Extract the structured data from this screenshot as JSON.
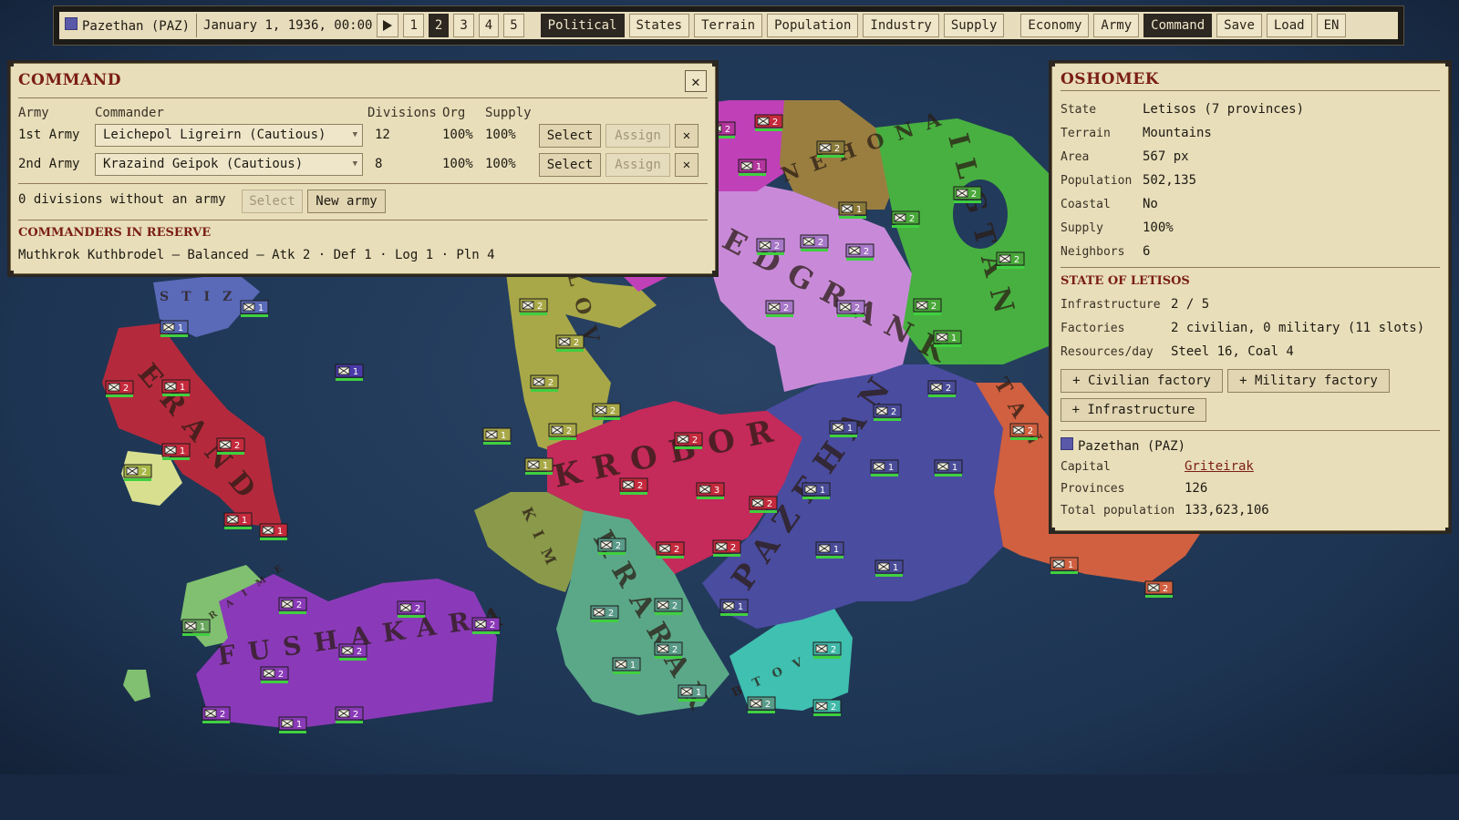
{
  "topbar": {
    "country": "Pazethan (PAZ)",
    "country_color": "#5a58a8",
    "date": "January 1, 1936, 00:00",
    "speeds": [
      "1",
      "2",
      "3",
      "4",
      "5"
    ],
    "active_speed": "2",
    "map_modes": [
      "Political",
      "States",
      "Terrain",
      "Population",
      "Industry",
      "Supply"
    ],
    "active_map_mode": "Political",
    "menus": [
      "Economy",
      "Army",
      "Command",
      "Save",
      "Load",
      "EN"
    ],
    "active_menu": "Command"
  },
  "command": {
    "title": "COMMAND",
    "headers": {
      "army": "Army",
      "commander": "Commander",
      "divisions": "Divisions",
      "org": "Org",
      "supply": "Supply"
    },
    "armies": [
      {
        "name": "1st Army",
        "commander": "Leichepol Ligreirn (Cautious)",
        "divisions": "12",
        "org": "100%",
        "supply": "100%"
      },
      {
        "name": "2nd Army",
        "commander": "Krazaind Geipok (Cautious)",
        "divisions": "8",
        "org": "100%",
        "supply": "100%"
      }
    ],
    "select_label": "Select",
    "assign_label": "Assign",
    "unassigned_text": "0 divisions without an army",
    "new_army_label": "New army",
    "reserve_title": "COMMANDERS IN RESERVE",
    "reserve_line": "Muthkrok Kuthbrodel — Balanced — Atk 2 · Def 1 · Log 1 · Pln 4"
  },
  "province": {
    "title": "OSHOMEK",
    "fields": [
      {
        "k": "State",
        "v": "Letisos (7 provinces)"
      },
      {
        "k": "Terrain",
        "v": "Mountains"
      },
      {
        "k": "Area",
        "v": "567 px"
      },
      {
        "k": "Population",
        "v": "502,135"
      },
      {
        "k": "Coastal",
        "v": "No"
      },
      {
        "k": "Supply",
        "v": "100%"
      },
      {
        "k": "Neighbors",
        "v": "6"
      }
    ],
    "state_title": "STATE OF LETISOS",
    "state_fields": [
      {
        "k": "Infrastructure",
        "v": "2 / 5"
      },
      {
        "k": "Factories",
        "v": "2 civilian, 0 military (11 slots)"
      },
      {
        "k": "Resources/day",
        "v": "Steel 16, Coal 4"
      }
    ],
    "buttons": {
      "civ": "+ Civilian factory",
      "mil": "+ Military factory",
      "infra": "+ Infrastructure"
    },
    "owner": "Pazethan (PAZ)",
    "owner_color": "#5a58a8",
    "owner_fields": [
      {
        "k": "Capital",
        "v": "Griteirak",
        "link": true
      },
      {
        "k": "Provinces",
        "v": "126"
      },
      {
        "k": "Total population",
        "v": "133,623,106"
      }
    ]
  },
  "map": {
    "labels": [
      "STIZ",
      "ERAND",
      "FUSHAKARA",
      "RAIME",
      "KROBOR",
      "LOV",
      "KIM",
      "KRARAK",
      "BTOV",
      "NEHONA",
      "EDGRANK",
      "PAZEHAN",
      "ILGTAN",
      "TAN",
      "OSHOMEK"
    ],
    "units": [
      {
        "n": "2",
        "c": "#c42a3c"
      },
      {
        "n": "2",
        "c": "#b4359e"
      },
      {
        "n": "1",
        "c": "#b4359e"
      },
      {
        "n": "2",
        "c": "#8a7a3a"
      },
      {
        "n": "1",
        "c": "#8a7a3a"
      },
      {
        "n": "2",
        "c": "#4aa83a"
      },
      {
        "n": "2",
        "c": "#4aa83a"
      },
      {
        "n": "2",
        "c": "#4aa83a"
      },
      {
        "n": "1",
        "c": "#4aa83a"
      },
      {
        "n": "2",
        "c": "#4aa83a"
      },
      {
        "n": "2",
        "c": "#a878c8"
      },
      {
        "n": "2",
        "c": "#a878c8"
      },
      {
        "n": "2",
        "c": "#a878c8"
      },
      {
        "n": "2",
        "c": "#a878c8"
      },
      {
        "n": "2",
        "c": "#a878c8"
      },
      {
        "n": "2",
        "c": "#4a4c98"
      },
      {
        "n": "1",
        "c": "#4a4c98"
      },
      {
        "n": "1",
        "c": "#4a4c98"
      },
      {
        "n": "1",
        "c": "#4a4c98"
      },
      {
        "n": "2",
        "c": "#4a4c98"
      },
      {
        "n": "1",
        "c": "#4a4c98"
      },
      {
        "n": "1",
        "c": "#4a4c98"
      },
      {
        "n": "1",
        "c": "#4a4c98"
      },
      {
        "n": "1",
        "c": "#4a4c98"
      },
      {
        "n": "2",
        "c": "#c42a3c"
      },
      {
        "n": "3",
        "c": "#c42a3c"
      },
      {
        "n": "2",
        "c": "#c42a3c"
      },
      {
        "n": "2",
        "c": "#c42a3c"
      },
      {
        "n": "2",
        "c": "#c42a3c"
      },
      {
        "n": "2",
        "c": "#c42a3c"
      },
      {
        "n": "2",
        "c": "#a8a848"
      },
      {
        "n": "2",
        "c": "#a8a848"
      },
      {
        "n": "2",
        "c": "#a8a848"
      },
      {
        "n": "2",
        "c": "#a8a848"
      },
      {
        "n": "1",
        "c": "#a8a848"
      },
      {
        "n": "2",
        "c": "#a8a848"
      },
      {
        "n": "2",
        "c": "#5a9a88"
      },
      {
        "n": "2",
        "c": "#5a9a88"
      },
      {
        "n": "2",
        "c": "#5a9a88"
      },
      {
        "n": "1",
        "c": "#5a9a88"
      },
      {
        "n": "2",
        "c": "#5a9a88"
      },
      {
        "n": "1",
        "c": "#5a9a88"
      },
      {
        "n": "2",
        "c": "#5a9a88"
      },
      {
        "n": "2",
        "c": "#40b8a8"
      },
      {
        "n": "2",
        "c": "#40b8a8"
      },
      {
        "n": "2",
        "c": "#8a3ab8"
      },
      {
        "n": "2",
        "c": "#8a3ab8"
      },
      {
        "n": "2",
        "c": "#8a3ab8"
      },
      {
        "n": "2",
        "c": "#8a3ab8"
      },
      {
        "n": "2",
        "c": "#8a3ab8"
      },
      {
        "n": "1",
        "c": "#8a3ab8"
      },
      {
        "n": "2",
        "c": "#8a3ab8"
      },
      {
        "n": "2",
        "c": "#8a3ab8"
      },
      {
        "n": "1",
        "c": "#6aa860"
      },
      {
        "n": "2",
        "c": "#c42a3c"
      },
      {
        "n": "1",
        "c": "#c42a3c"
      },
      {
        "n": "2",
        "c": "#c42a3c"
      },
      {
        "n": "1",
        "c": "#c42a3c"
      },
      {
        "n": "1",
        "c": "#c42a3c"
      },
      {
        "n": "1",
        "c": "#c42a3c"
      },
      {
        "n": "2",
        "c": "#a8b848"
      },
      {
        "n": "1",
        "c": "#5a6ab8"
      },
      {
        "n": "1",
        "c": "#5a6ab8"
      },
      {
        "n": "1",
        "c": "#4a3aa8"
      },
      {
        "n": "1",
        "c": "#a8a848"
      },
      {
        "n": "2",
        "c": "#d06040"
      },
      {
        "n": "1",
        "c": "#d06040"
      },
      {
        "n": "2",
        "c": "#d06040"
      }
    ]
  }
}
